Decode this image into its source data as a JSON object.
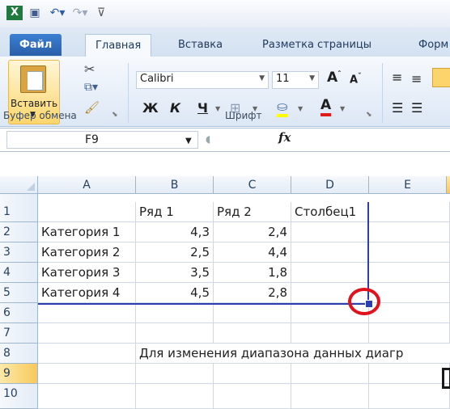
{
  "tabs": {
    "file": "Файл",
    "home": "Главная",
    "insert": "Вставка",
    "layout": "Разметка страницы",
    "formulas": "Форм"
  },
  "ribbon": {
    "paste": "Вставить",
    "clipboard_group": "Буфер обмена",
    "font_name": "Calibri",
    "font_size": "11",
    "bold": "Ж",
    "italic": "К",
    "underline": "Ч",
    "font_group": "Шрифт"
  },
  "formula_bar": {
    "name_box": "F9",
    "fx": "fx",
    "value": ""
  },
  "columns": [
    "A",
    "B",
    "C",
    "D",
    "E"
  ],
  "rows": [
    "1",
    "2",
    "3",
    "4",
    "5",
    "6",
    "7",
    "8",
    "9",
    "10"
  ],
  "cells": {
    "B1": "Ряд 1",
    "C1": "Ряд 2",
    "D1": "Столбец1",
    "A2": "Категория 1",
    "B2": "4,3",
    "C2": "2,4",
    "A3": "Категория 2",
    "B3": "2,5",
    "C3": "4,4",
    "A4": "Категория 3",
    "B4": "3,5",
    "C4": "1,8",
    "A5": "Категория 4",
    "B5": "4,5",
    "C5": "2,8",
    "B8": "Для изменения диапазона данных диагр"
  },
  "colors": {
    "file_tab": "#2a5ea8",
    "range_border": "#2b3eb0",
    "highlight_circle": "#e0121b",
    "selected_row_header": "#f8d47a"
  }
}
